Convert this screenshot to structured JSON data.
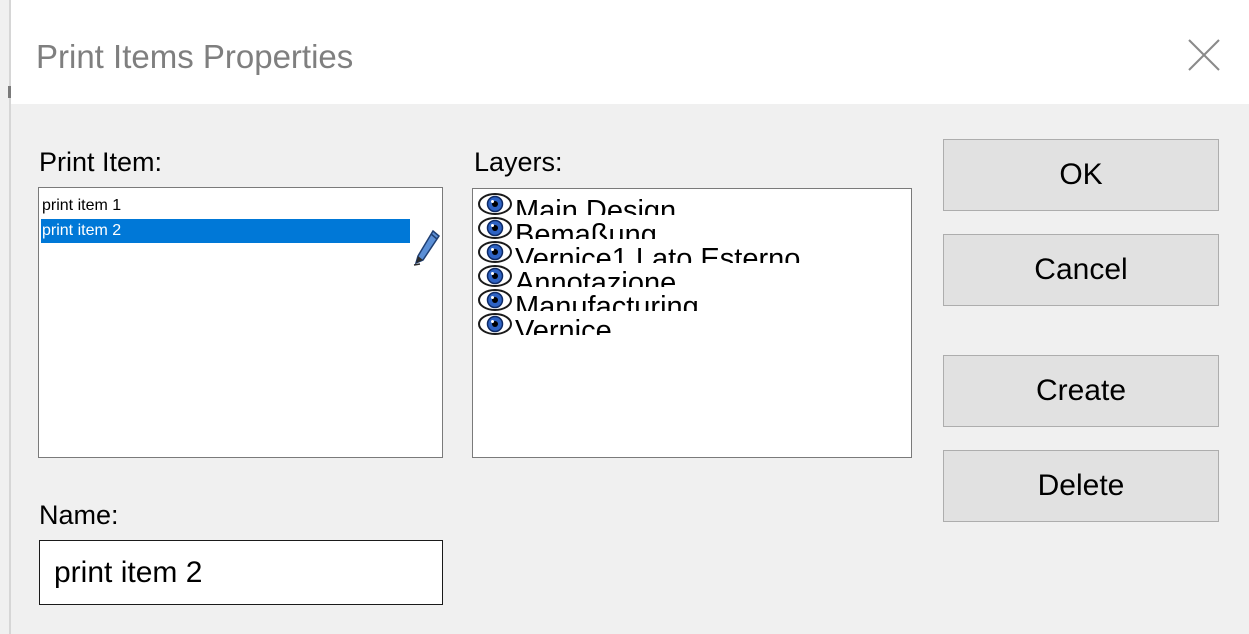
{
  "window": {
    "title": "Print Items Properties",
    "close_icon": "close-icon"
  },
  "print_item": {
    "label": "Print Item:",
    "items": [
      {
        "text": "print item 1",
        "selected": false
      },
      {
        "text": "print item 2",
        "selected": true
      }
    ],
    "edit_icon": "pencil-icon"
  },
  "layers": {
    "label": "Layers:",
    "icon": "eye-icon",
    "items": [
      {
        "text": "Main Design"
      },
      {
        "text": "Bemaßung"
      },
      {
        "text": "Vernice1 Lato Esterno"
      },
      {
        "text": "Annotazione"
      },
      {
        "text": "Manufacturing"
      },
      {
        "text": "Vernice"
      }
    ]
  },
  "name": {
    "label": "Name:",
    "value": "print item 2"
  },
  "buttons": {
    "ok": "OK",
    "cancel": "Cancel",
    "create": "Create",
    "delete": "Delete"
  },
  "colors": {
    "selection": "#0078d7",
    "background": "#f0f0f0",
    "button_face": "#e1e1e1",
    "title_text": "#7f7f7f"
  }
}
